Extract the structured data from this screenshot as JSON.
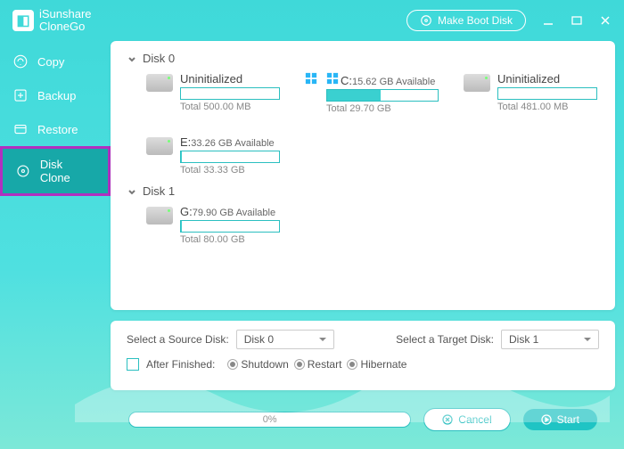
{
  "app": {
    "brand_line1": "iSunshare",
    "brand_line2": "CloneGo",
    "make_boot": "Make Boot Disk"
  },
  "sidebar": {
    "items": [
      {
        "label": "Copy"
      },
      {
        "label": "Backup"
      },
      {
        "label": "Restore"
      },
      {
        "label": "Disk Clone"
      }
    ]
  },
  "disks": [
    {
      "name": "Disk 0",
      "parts": [
        {
          "label": "Uninitialized",
          "avail": "",
          "total": "Total 500.00 MB",
          "fill": 0,
          "win": false
        },
        {
          "label": "C:",
          "avail": "15.62 GB Available",
          "total": "Total 29.70 GB",
          "fill": 48,
          "win": true
        },
        {
          "label": "Uninitialized",
          "avail": "",
          "total": "Total 481.00 MB",
          "fill": 0,
          "win": false
        },
        {
          "label": "E:",
          "avail": "33.26 GB Available",
          "total": "Total 33.33 GB",
          "fill": 1,
          "win": false
        }
      ]
    },
    {
      "name": "Disk 1",
      "parts": [
        {
          "label": "G:",
          "avail": "79.90 GB Available",
          "total": "Total 80.00 GB",
          "fill": 1,
          "win": false
        }
      ]
    }
  ],
  "options": {
    "source_label": "Select a Source Disk:",
    "source_value": "Disk 0",
    "target_label": "Select a Target Disk:",
    "target_value": "Disk 1",
    "after_label": "After Finished:",
    "radios": [
      "Shutdown",
      "Restart",
      "Hibernate"
    ]
  },
  "bottom": {
    "progress": "0%",
    "cancel": "Cancel",
    "start": "Start"
  }
}
